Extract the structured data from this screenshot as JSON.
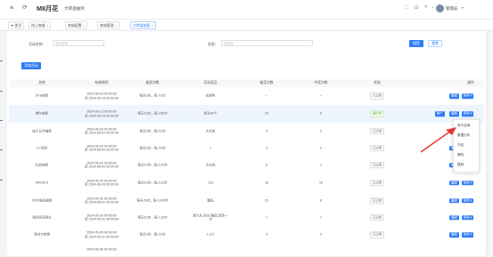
{
  "header": {
    "menu_icon": "≡",
    "refresh_icon": "⟳",
    "title": "M8月花",
    "subtitle": "大转盘抽奖",
    "fullscreen_icon": "⛶",
    "lock_icon": "⊡",
    "help_icon": "?",
    "bell_icon": "◔",
    "user_name": "管理员",
    "user_caret": "▾"
  },
  "tabs": [
    {
      "label": "首页",
      "icon": "★",
      "closable": false,
      "active": false
    },
    {
      "label": "线上商城",
      "closable": true,
      "active": false
    },
    {
      "label": "商城配置",
      "closable": true,
      "active": false
    },
    {
      "label": "商城管理",
      "closable": true,
      "active": false
    },
    {
      "label": "大转盘抽奖",
      "closable": true,
      "active": true
    }
  ],
  "tab_close_icon": "×",
  "filters": {
    "name_label": "活动名称：",
    "name_placeholder": "活动名称",
    "status_label": "状态：",
    "status_placeholder": "请选择",
    "status_caret": "⌄",
    "search_button": "搜索",
    "reset_button": "重置"
  },
  "add_button": "添加活动",
  "table": {
    "headers": [
      "名称",
      "有效期间",
      "抽奖次数",
      "活动奖品",
      "抽奖次数",
      "中奖次数",
      "状态",
      "操作"
    ],
    "rows": [
      {
        "name": "开卡抽奖",
        "period": [
          "2024-06-18 00:00:00",
          "至 2024-06-19 00:00:00"
        ],
        "times": "每天0次，每人0次",
        "prize": "优惠劵",
        "draws": "--",
        "wins": "--",
        "status": "已过期",
        "active": false,
        "actions": [
          "编辑",
          "操作 ▾"
        ]
      },
      {
        "name": "端午抽奖",
        "period": [
          "2024-06-13 00:00:00",
          "至 2024-06-13 00:00:00"
        ],
        "times": "每天10次，每人50次",
        "prize": "积分50个",
        "draws": "24",
        "wins": "5",
        "status": "进行中",
        "active": true,
        "actions": [
          "推广",
          "编辑",
          "操作 ▾"
        ]
      },
      {
        "name": "成于五月抽奖",
        "period": [
          "2024-06-03 00:00:00",
          "至 2024-06-04 00:00:00"
        ],
        "times": "每天5次，每人5次",
        "prize": "大礼包",
        "draws": "3",
        "wins": "2",
        "status": "已过期",
        "active": false,
        "actions": [
          "编辑",
          "操作 ▾"
        ]
      },
      {
        "name": "2.1测试",
        "period": [
          "2024-06-03 00:00:00",
          "至 2024-06-03 00:00:00"
        ],
        "times": "每天5次，每人5次",
        "prize": "1",
        "draws": "3",
        "wins": "2",
        "status": "已过期",
        "active": false,
        "actions": [
          "编辑",
          "操作 ▾"
        ]
      },
      {
        "name": "礼品抽奖",
        "period": [
          "2024-06-03 00:00:00",
          "至 2024-06-03 00:00:00"
        ],
        "times": "每天10次，每人10次",
        "prize": "大礼包",
        "draws": "5",
        "wins": "1",
        "status": "已过期",
        "active": false,
        "actions": [
          "编辑",
          "操作 ▾"
        ]
      },
      {
        "name": "M4100.5",
        "period": [
          "2024-06-03 00:00:00",
          "至 2024-06-03 00:00:00"
        ],
        "times": "每天10次，每人10次",
        "prize": "123",
        "draws": "16",
        "wins": "10",
        "status": "已过期",
        "active": false,
        "actions": [
          "编辑",
          "操作 ▾"
        ]
      },
      {
        "name": "0501测品抽奖",
        "period": [
          "2024-05-31 00:00:00",
          "至 2024-06-01 00:00:00"
        ],
        "times": "每天20次，每人100次",
        "prize": "赠品",
        "draws": "21",
        "wins": "8",
        "status": "已过期",
        "active": false,
        "actions": [
          "编辑",
          "操作 ▾"
        ]
      },
      {
        "name": "测试商品测试",
        "period": [
          "2024-05-30 00:00:00",
          "至 2024-05-31 00:00:00"
        ],
        "times": "每天10次，每人10次",
        "prize": [
          "新九礼,积分,赠品,现场一",
          "次"
        ],
        "draws": "1",
        "wins": "1",
        "status": "已过期",
        "active": false,
        "actions": [
          "编辑",
          "操作 ▾"
        ]
      },
      {
        "name": "测试大转盘",
        "period": [
          "2024-05-30 00:00:00",
          "至 2024-05-31 00:00:00"
        ],
        "times": "每天5次，每人5次",
        "prize": "1,122",
        "draws": "3",
        "wins": "2",
        "status": "已过期",
        "active": false,
        "actions": [
          "编辑",
          "操作 ▾"
        ]
      },
      {
        "name": "",
        "period": [
          "2024-05-30 00:00:00",
          ""
        ],
        "times": "",
        "prize": "",
        "draws": "",
        "wins": "",
        "status": "",
        "active": false,
        "actions": []
      }
    ]
  },
  "dropdown_menu": [
    "参与名单",
    "数据分析",
    "开启",
    "删除",
    "复制"
  ],
  "colors": {
    "primary": "#2f7cf6",
    "arrow": "#e53935",
    "active_status": "#5fb33a"
  }
}
